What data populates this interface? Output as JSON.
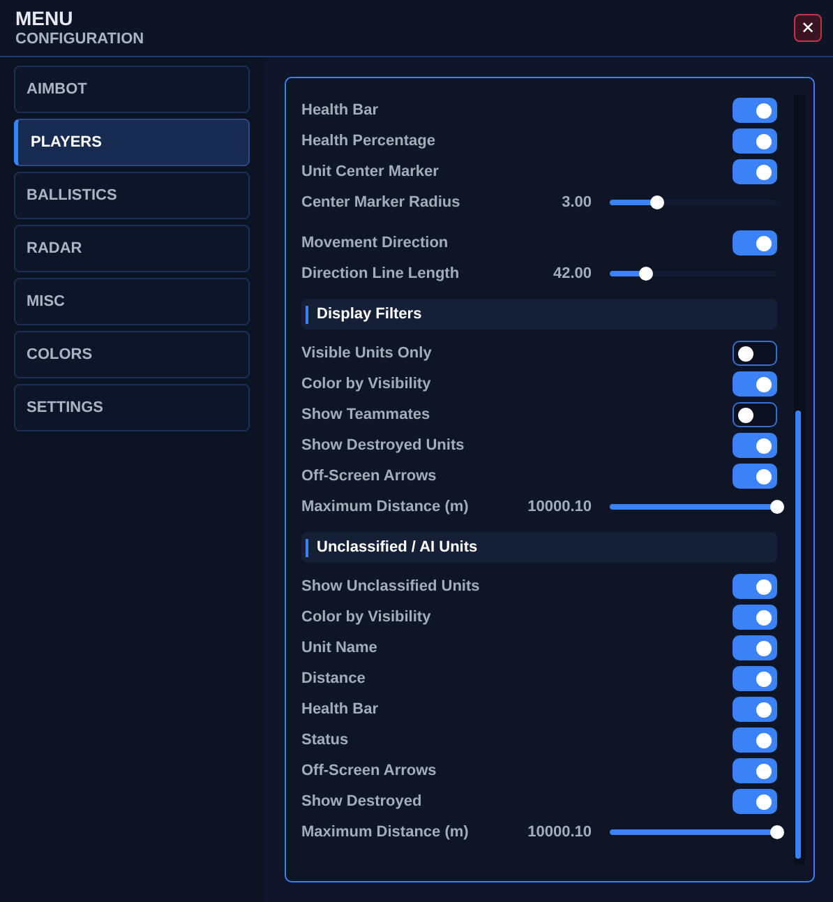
{
  "window": {
    "title": "MENU",
    "subtitle": "CONFIGURATION",
    "close": "✕"
  },
  "sidebar": {
    "items": [
      {
        "label": "AIMBOT",
        "selected": false
      },
      {
        "label": "PLAYERS",
        "selected": true
      },
      {
        "label": "BALLISTICS",
        "selected": false
      },
      {
        "label": "RADAR",
        "selected": false
      },
      {
        "label": "MISC",
        "selected": false
      },
      {
        "label": "COLORS",
        "selected": false
      },
      {
        "label": "SETTINGS",
        "selected": false
      }
    ]
  },
  "sections": [
    {
      "groups": [
        [
          {
            "kind": "toggle",
            "label": "Health Bar",
            "on": true
          },
          {
            "kind": "toggle",
            "label": "Health Percentage",
            "on": true
          },
          {
            "kind": "toggle",
            "label": "Unit Center Marker",
            "on": true
          },
          {
            "kind": "slider",
            "label": "Center Marker Radius",
            "reading": "3.00",
            "level": 0.28
          }
        ],
        [
          {
            "kind": "toggle",
            "label": "Movement Direction",
            "on": true
          },
          {
            "kind": "slider",
            "label": "Direction Line Length",
            "reading": "42.00",
            "level": 0.22
          }
        ]
      ]
    },
    {
      "header": "Display Filters",
      "groups": [
        [
          {
            "kind": "toggle",
            "label": "Visible Units Only",
            "on": false
          },
          {
            "kind": "toggle",
            "label": "Color by Visibility",
            "on": true
          },
          {
            "kind": "toggle",
            "label": "Show Teammates",
            "on": false
          },
          {
            "kind": "toggle",
            "label": "Show Destroyed Units",
            "on": true
          },
          {
            "kind": "toggle",
            "label": "Off-Screen Arrows",
            "on": true
          },
          {
            "kind": "slider",
            "label": "Maximum Distance (m)",
            "reading": "10000.10",
            "level": 1
          }
        ]
      ]
    },
    {
      "header": "Unclassified / AI Units",
      "groups": [
        [
          {
            "kind": "toggle",
            "label": "Show Unclassified Units",
            "on": true
          },
          {
            "kind": "toggle",
            "label": "Color by Visibility",
            "on": true
          },
          {
            "kind": "toggle",
            "label": "Unit Name",
            "on": true
          },
          {
            "kind": "toggle",
            "label": "Distance",
            "on": true
          },
          {
            "kind": "toggle",
            "label": "Health Bar",
            "on": true
          },
          {
            "kind": "toggle",
            "label": "Status",
            "on": true
          },
          {
            "kind": "toggle",
            "label": "Off-Screen Arrows",
            "on": true
          },
          {
            "kind": "toggle",
            "label": "Show Destroyed",
            "on": true
          },
          {
            "kind": "slider",
            "label": "Maximum Distance (m)",
            "reading": "10000.10",
            "level": 1
          }
        ]
      ]
    }
  ]
}
